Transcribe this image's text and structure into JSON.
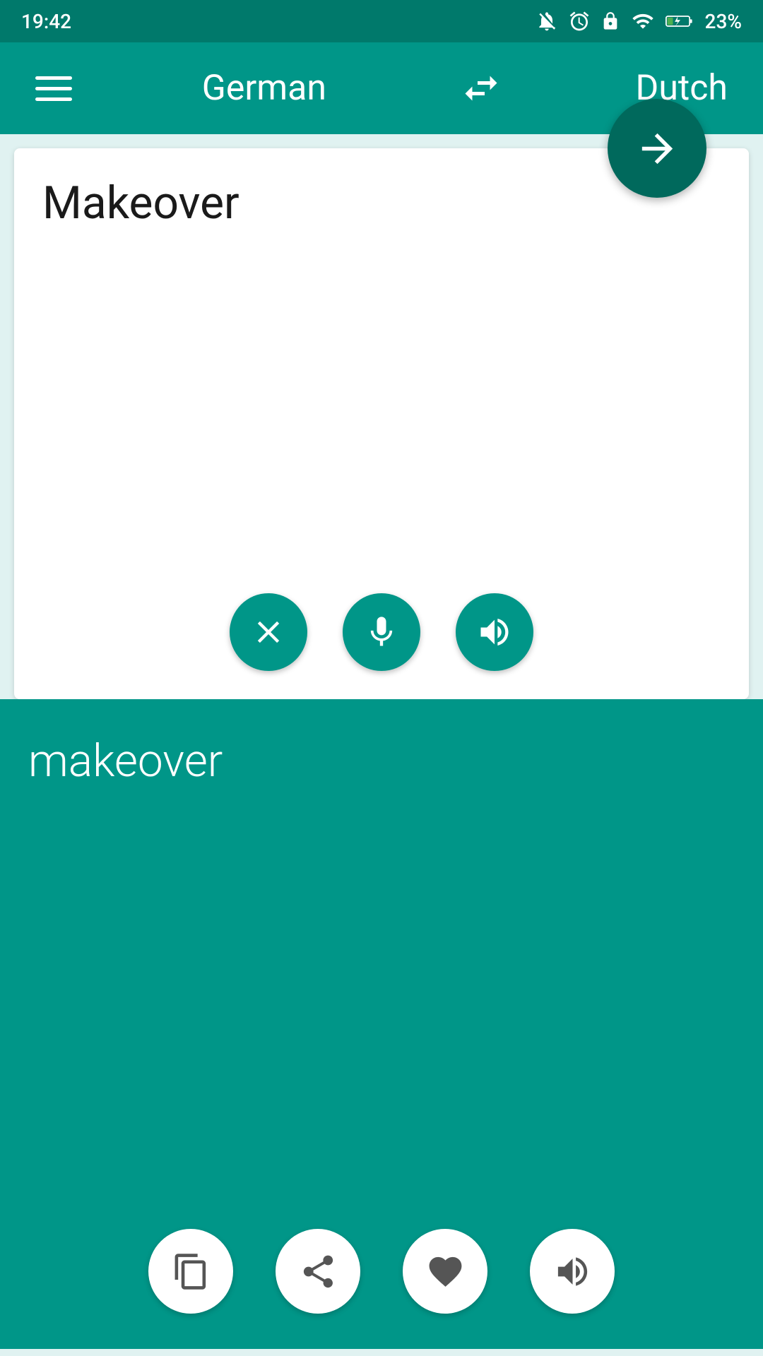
{
  "statusBar": {
    "time": "19:42",
    "battery": "23%"
  },
  "header": {
    "menuLabel": "menu",
    "sourceLang": "German",
    "swapLabel": "swap languages",
    "targetLang": "Dutch"
  },
  "inputSection": {
    "text": "Makeover",
    "clearLabel": "clear",
    "micLabel": "microphone",
    "speakLabel": "speak source"
  },
  "fab": {
    "label": "translate"
  },
  "resultSection": {
    "text": "makeover",
    "copyLabel": "copy",
    "shareLabel": "share",
    "favoriteLabel": "favorite",
    "speakLabel": "speak result"
  }
}
